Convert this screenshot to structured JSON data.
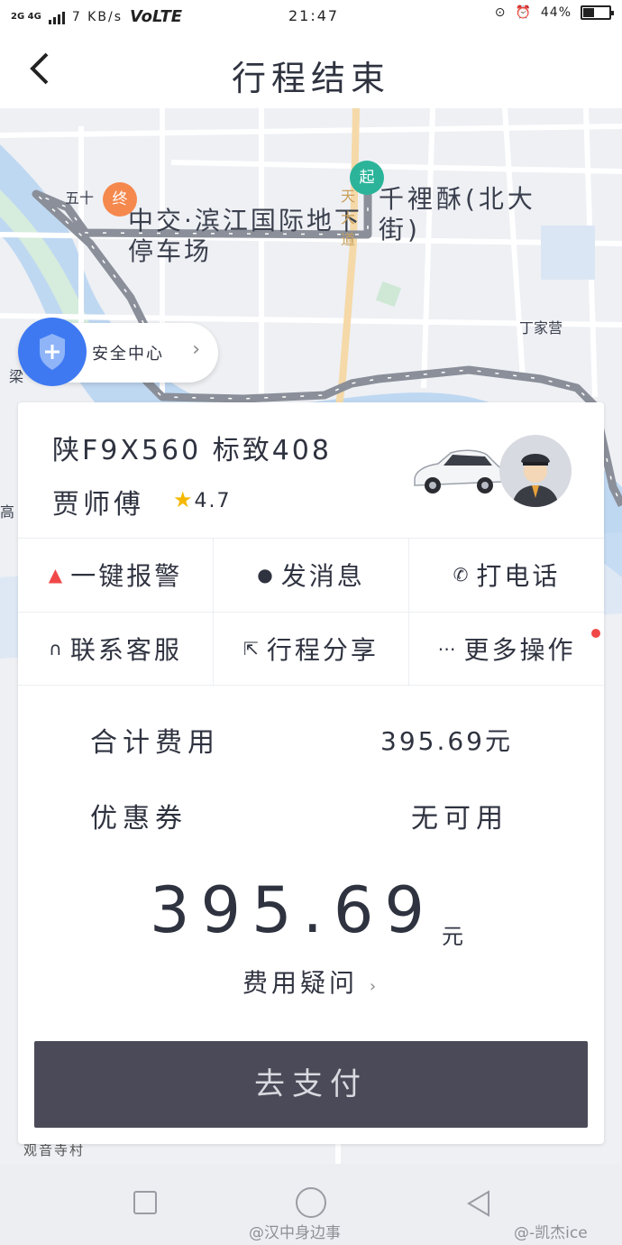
{
  "status_bar": {
    "network": "2G 4G",
    "speed": "7 KB/s",
    "volte": "VoLTE",
    "time": "21:47",
    "battery": "44%",
    "battery_level": 0.44
  },
  "header": {
    "back_icon": "chevron-left-icon",
    "title": "行程结束"
  },
  "map": {
    "start_pin": "起",
    "end_pin": "终",
    "start_place": "千裡酥(北大街)",
    "end_place": "中交·滨江国际地下停车场",
    "labels": {
      "wushi": "五十",
      "tiandao": "天大道",
      "dingjiaying": "丁家营",
      "liang": "梁",
      "gao": "高",
      "guanyinsi": "观音寺村"
    }
  },
  "safety": {
    "icon": "shield-plus-icon",
    "label": "安全中心"
  },
  "trip": {
    "plate_and_car": "陕F9X560 标致408",
    "driver": "贾师傅",
    "rating": "4.7"
  },
  "actions": [
    {
      "icon": "alarm-icon",
      "label": "一键报警"
    },
    {
      "icon": "message-icon",
      "label": "发消息"
    },
    {
      "icon": "phone-icon",
      "label": "打电话"
    },
    {
      "icon": "headset-icon",
      "label": "联系客服"
    },
    {
      "icon": "share-icon",
      "label": "行程分享"
    },
    {
      "icon": "more-icon",
      "label": "更多操作"
    }
  ],
  "fees": {
    "total_label": "合计费用",
    "total_value": "395.69元",
    "coupon_label": "优惠券",
    "coupon_value": "无可用",
    "amount": "395.69",
    "amount_unit": "元",
    "question": "费用疑问"
  },
  "pay_button": "去支付",
  "watermarks": {
    "left": "@汉中身边事",
    "right": "@-凯杰ice"
  },
  "colors": {
    "start_pin": "#2bb49a",
    "end_pin": "#f5884d",
    "pay_button": "#4a4a58",
    "safety_shield": "#3e79f2",
    "star": "#f5b800",
    "alarm": "#f04848"
  }
}
